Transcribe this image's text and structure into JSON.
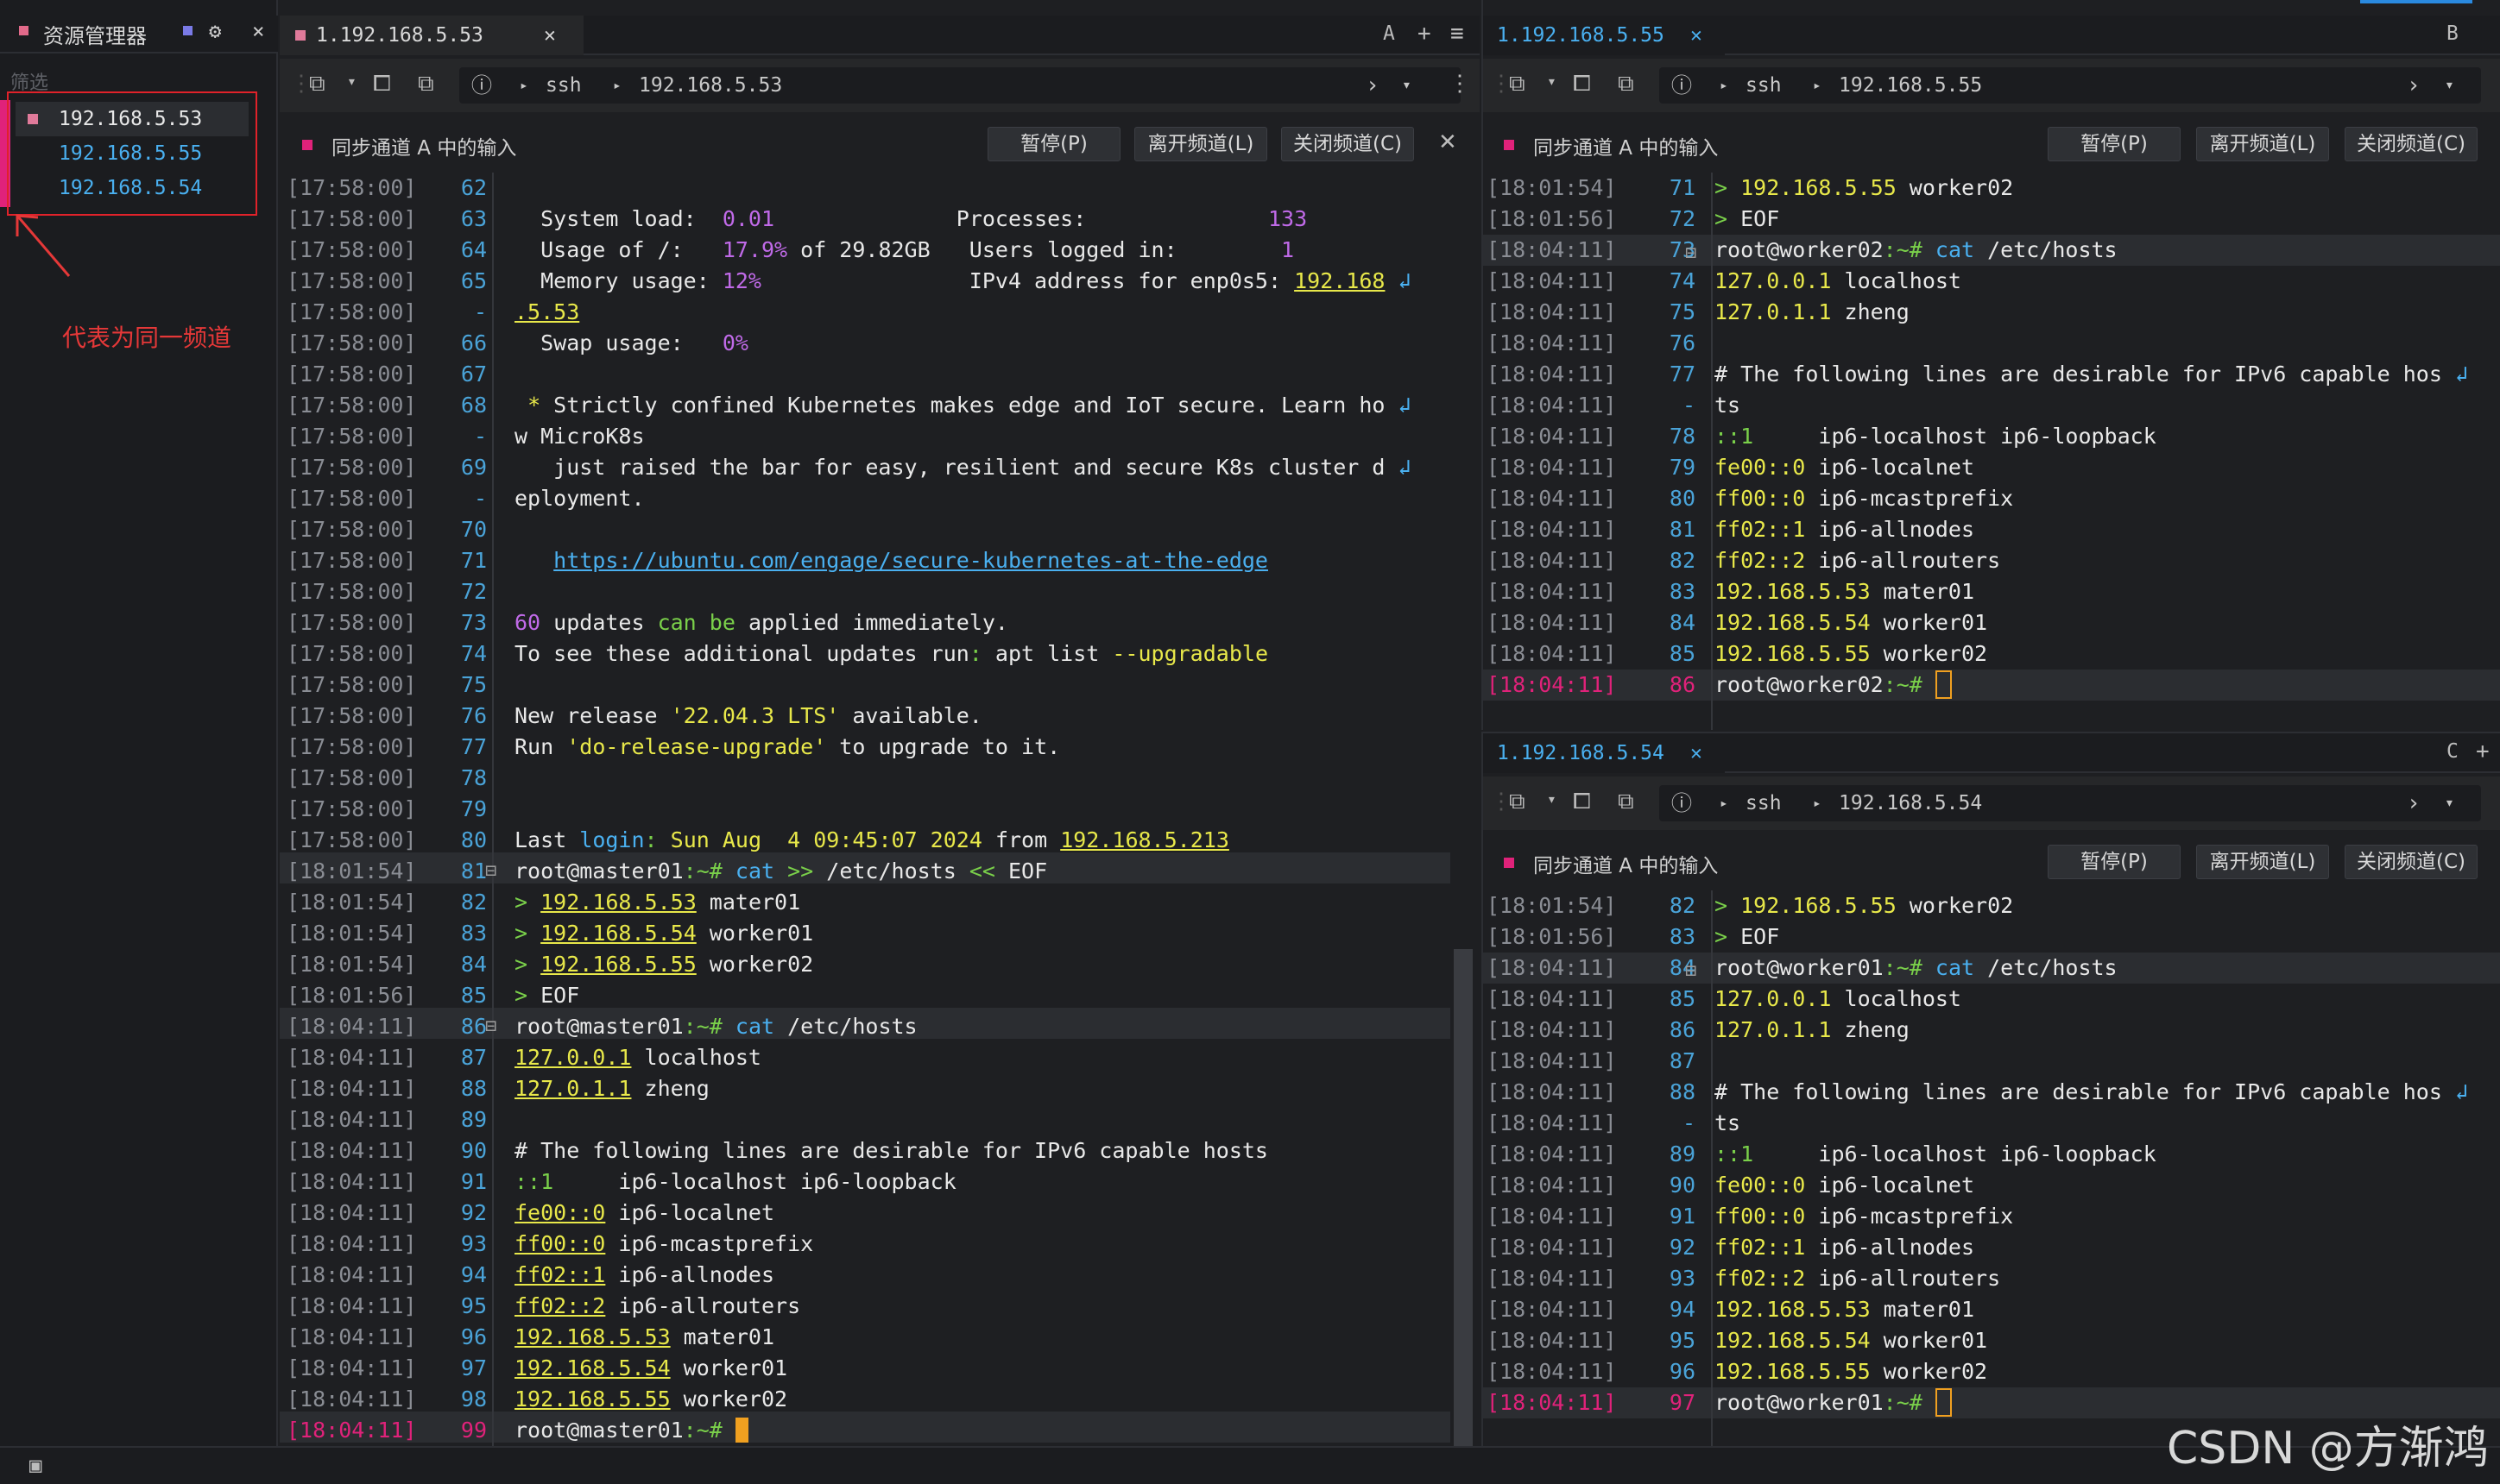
{
  "sidebar": {
    "title": "资源管理器",
    "filter": "筛选",
    "items": [
      "192.168.5.53",
      "192.168.5.55",
      "192.168.5.54"
    ],
    "annotation": "代表为同一频道"
  },
  "left": {
    "tab": "1.192.168.5.53",
    "tab_letter": "A",
    "proto": "ssh",
    "host": "192.168.5.53",
    "sync": {
      "label": "同步通道 A 中的输入",
      "pause": "暂停(P)",
      "leave": "离开频道(L)",
      "close": "关闭频道(C)"
    }
  },
  "right_top": {
    "tab": "1.192.168.5.55",
    "tab_letter": "B",
    "proto": "ssh",
    "host": "192.168.5.55",
    "sync": {
      "label": "同步通道 A 中的输入",
      "pause": "暂停(P)",
      "leave": "离开频道(L)",
      "close": "关闭频道(C)"
    }
  },
  "right_bottom": {
    "tab": "1.192.168.5.54",
    "tab_letter": "C",
    "proto": "ssh",
    "host": "192.168.5.54",
    "sync": {
      "label": "同步通道 A 中的输入",
      "pause": "暂停(P)",
      "leave": "离开频道(L)",
      "close": "关闭频道(C)"
    }
  },
  "watermark": "CSDN @方渐鸿",
  "accent": "#e0227a"
}
